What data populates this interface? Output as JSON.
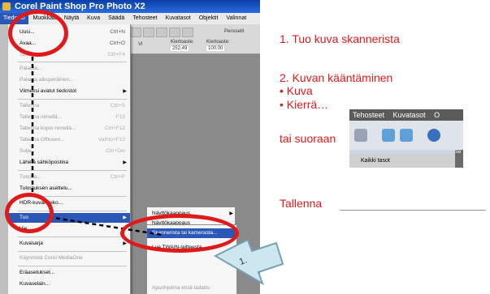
{
  "window": {
    "title": "Corel Paint Shop Pro Photo X2"
  },
  "menubar": {
    "items": [
      "Tiedosto",
      "Muokkaa",
      "Näytä",
      "Kuva",
      "Säädä",
      "Tehosteet",
      "Kuvatasot",
      "Objektit",
      "Valinnat"
    ]
  },
  "toolbar": {
    "left_text": "Vl",
    "labels": [
      "Kiertoaste:",
      "Kiertoaste:",
      "Pensselit"
    ],
    "fields": [
      "252.49",
      "100.00"
    ]
  },
  "file_menu": {
    "items": [
      {
        "label": "Uusi...",
        "shortcut": "Ctrl+N",
        "enabled": true
      },
      {
        "label": "Avaa...",
        "shortcut": "Ctrl+O",
        "enabled": true
      },
      {
        "label": "Tuo...",
        "shortcut": "Ctrl+F4",
        "enabled": false
      },
      {
        "label": "Palauta...",
        "shortcut": "",
        "enabled": false
      },
      {
        "label": "Palauta alkuperäinen...",
        "shortcut": "",
        "enabled": false
      },
      {
        "label": "Viimeksi avatut tiedostot",
        "shortcut": "",
        "enabled": true,
        "submenu": true
      },
      {
        "label": "Tallenna",
        "shortcut": "Ctrl+S",
        "enabled": false
      },
      {
        "label": "Tallenna nimellä...",
        "shortcut": "F12",
        "enabled": false
      },
      {
        "label": "Tallenna kopio nimellä...",
        "shortcut": "Ctrl+F12",
        "enabled": false
      },
      {
        "label": "Tallenna Officeen...",
        "shortcut": "Vaihto+F12",
        "enabled": false
      },
      {
        "label": "Sulje",
        "shortcut": "Ctrl+Del",
        "enabled": false
      },
      {
        "label": "Lähetä sähköpostina",
        "shortcut": "",
        "enabled": true,
        "submenu": true
      },
      {
        "label": "Tulosta...",
        "shortcut": "Ctrl+P",
        "enabled": false
      },
      {
        "label": "Tulostuksen asettelu...",
        "shortcut": "",
        "enabled": true
      },
      {
        "label": "HDR-kuvan teko...",
        "shortcut": "",
        "enabled": true
      },
      {
        "label": "Tuo",
        "shortcut": "",
        "enabled": true,
        "submenu": true,
        "highlighted": true
      },
      {
        "label": "Vie",
        "shortcut": "",
        "enabled": true,
        "submenu": true
      },
      {
        "label": "Kuvasarja",
        "shortcut": "",
        "enabled": true,
        "submenu": true
      },
      {
        "label": "Käynnistä Corel MediaOne",
        "shortcut": "",
        "enabled": false
      },
      {
        "label": "Eräasetukset...",
        "shortcut": "",
        "enabled": true
      },
      {
        "label": "Kuvaselain...",
        "shortcut": "",
        "enabled": true
      }
    ]
  },
  "submenu_tuo": {
    "items": [
      {
        "label": "Näyttökaappaus",
        "highlighted": false,
        "enabled": true
      },
      {
        "label": "Näyttökaappaus",
        "highlighted": false,
        "enabled": true
      },
      {
        "label": "Skannerista tai kamerasta...",
        "highlighted": true,
        "enabled": true
      },
      {
        "label": "Lue TWAIN-laitteesta...",
        "highlighted": false,
        "enabled": true
      },
      {
        "label": "",
        "highlighted": false,
        "enabled": false
      },
      {
        "label": "",
        "highlighted": false,
        "enabled": false
      },
      {
        "label": "Apuohjelma etsiä ladattu",
        "highlighted": false,
        "enabled": false
      }
    ]
  },
  "arrow_label": "1.",
  "instructions": {
    "step1": "1. Tuo kuva skannerista",
    "step2": "2. Kuvan kääntäminen",
    "bullet1": "• Kuva",
    "bullet2": "• Kierrä…",
    "or_direct": "tai suoraan",
    "save": "Tallenna"
  },
  "mini_toolbar": {
    "menu": [
      "Tehosteet",
      "Kuvatasot",
      "O"
    ],
    "footer": "Kaikki tasot",
    "side_label": "Se"
  },
  "colors": {
    "annotation_red": "#e0191b",
    "highlight_blue": "#2b57b7"
  }
}
